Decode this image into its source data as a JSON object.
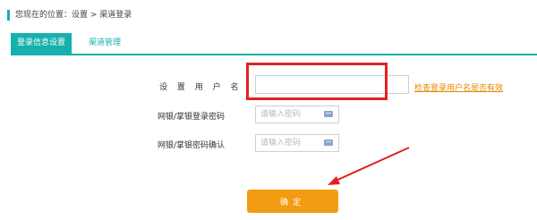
{
  "breadcrumb": {
    "text": "您现在的位置：设置 > 渠道登录",
    "accent_color": "#16b0ad"
  },
  "tabs": [
    {
      "label": "登录信息设置",
      "active": true
    },
    {
      "label": "渠道管理",
      "active": false
    }
  ],
  "form": {
    "username_label": "设 置 用 户 名",
    "username_value": "",
    "check_link": "检查登录用户名是否有效",
    "password_label": "网银/掌银登录密码",
    "password_placeholder": "请输入密码",
    "confirm_label": "网银/掌银密码确认",
    "confirm_placeholder": "请输入密码",
    "keyboard_icon": "keyboard-icon",
    "submit_label": "确定"
  },
  "annotations": {
    "highlight_color": "#e12222"
  },
  "colors": {
    "accent": "#16b0ad",
    "submit": "#f39c12",
    "link": "#e68a00"
  }
}
